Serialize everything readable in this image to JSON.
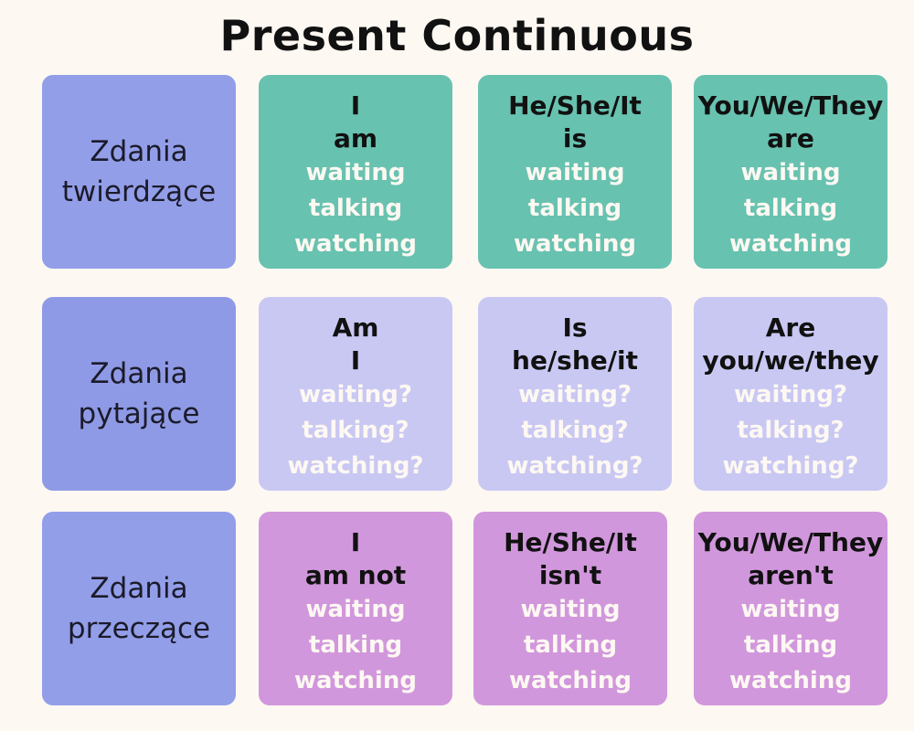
{
  "title": "Present Continuous",
  "rows": [
    {
      "label": [
        "Zdania",
        "twierdzące"
      ],
      "cells": [
        {
          "head": [
            "I",
            "am"
          ],
          "verbs": [
            "waiting",
            "talking",
            "watching"
          ]
        },
        {
          "head": [
            "He/She/It",
            "is"
          ],
          "verbs": [
            "waiting",
            "talking",
            "watching"
          ]
        },
        {
          "head": [
            "You/We/They",
            "are"
          ],
          "verbs": [
            "waiting",
            "talking",
            "watching"
          ]
        }
      ]
    },
    {
      "label": [
        "Zdania",
        "pytające"
      ],
      "cells": [
        {
          "head": [
            "Am",
            "I"
          ],
          "verbs": [
            "waiting?",
            "talking?",
            "watching?"
          ]
        },
        {
          "head": [
            "Is",
            "he/she/it"
          ],
          "verbs": [
            "waiting?",
            "talking?",
            "watching?"
          ]
        },
        {
          "head": [
            "Are",
            "you/we/they"
          ],
          "verbs": [
            "waiting?",
            "talking?",
            "watching?"
          ]
        }
      ]
    },
    {
      "label": [
        "Zdania",
        "przeczące"
      ],
      "cells": [
        {
          "head": [
            "I",
            "am not"
          ],
          "verbs": [
            "waiting",
            "talking",
            "watching"
          ]
        },
        {
          "head": [
            "He/She/It",
            "isn't"
          ],
          "verbs": [
            "waiting",
            "talking",
            "watching"
          ]
        },
        {
          "head": [
            "You/We/They",
            "aren't"
          ],
          "verbs": [
            "waiting",
            "talking",
            "watching"
          ]
        }
      ]
    }
  ],
  "colors": {
    "background": "#fdf8f2",
    "label_card": "#939ee9",
    "affirmative_card": "#68c2b0",
    "question_card": "#c9c8f3",
    "negative_card": "#d197dc",
    "verb_text": "#fdf8f2"
  }
}
